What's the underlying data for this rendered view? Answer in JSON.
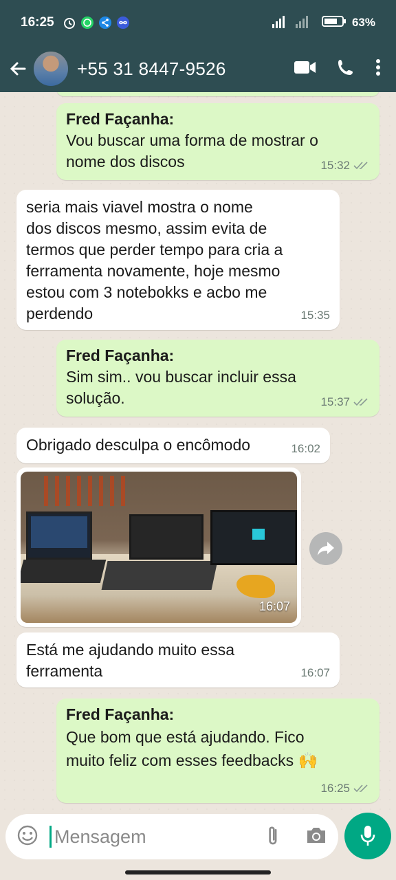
{
  "status_bar": {
    "time": "16:25",
    "battery": "63%"
  },
  "header": {
    "contact": "+55 31 8447-9526"
  },
  "messages": [
    {
      "direction": "out",
      "sender": "Fred Façanha:",
      "text": "Vou buscar uma forma de mostrar o\nnome dos discos",
      "time": "15:32"
    },
    {
      "direction": "in",
      "text": "seria mais viavel mostra o nome\ndos discos mesmo, assim evita de\ntermos que perder tempo para cria a\nferramenta novamente, hoje mesmo\nestou com 3 notebokks e acbo me\nperdendo",
      "time": "15:35"
    },
    {
      "direction": "out",
      "sender": "Fred Façanha:",
      "text": "Sim sim.. vou buscar incluir essa\nsolução.",
      "time": "15:37"
    },
    {
      "direction": "in",
      "text": "Obrigado desculpa o encômodo",
      "time": "16:02"
    },
    {
      "direction": "in",
      "type": "image",
      "time": "16:07"
    },
    {
      "direction": "in",
      "text": "Está me ajudando muito essa\nferramenta",
      "time": "16:07"
    },
    {
      "direction": "out",
      "sender": "Fred Façanha:",
      "text": "Que bom que está ajudando. Fico\nmuito feliz com esses feedbacks 🙌",
      "time": "16:25"
    }
  ],
  "composer": {
    "placeholder": "Mensagem"
  },
  "colors": {
    "header": "#2e4d52",
    "outgoing_bubble": "#dcf8c6",
    "incoming_bubble": "#ffffff",
    "accent": "#00a884"
  },
  "icons": [
    "back-arrow-icon",
    "video-call-icon",
    "phone-icon",
    "more-vert-icon",
    "emoji-icon",
    "attach-icon",
    "camera-icon",
    "mic-icon",
    "forward-icon",
    "double-check-icon"
  ]
}
